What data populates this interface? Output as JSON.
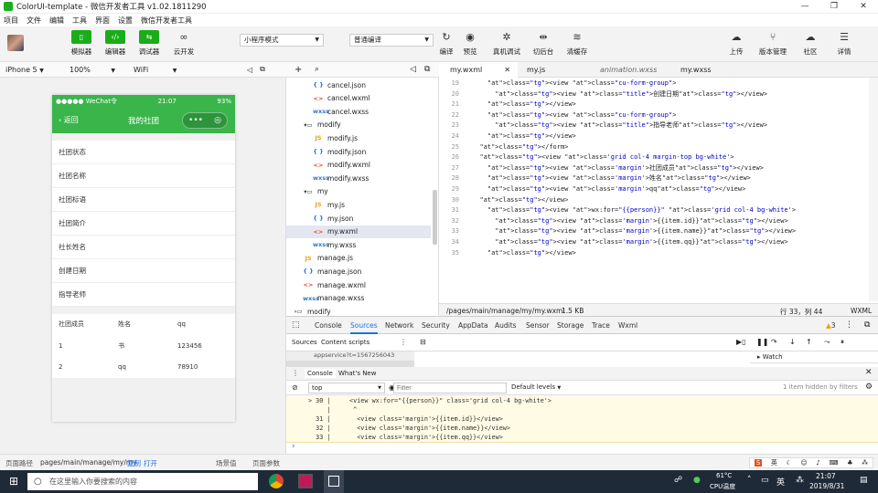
{
  "window": {
    "title": "ColorUI-template - 微信开发者工具 v1.02.1811290",
    "minimize": "—",
    "maximize": "❐",
    "close": "✕"
  },
  "menu": [
    "项目",
    "文件",
    "编辑",
    "工具",
    "界面",
    "设置",
    "微信开发者工具"
  ],
  "toolbar": {
    "simulator": "模拟器",
    "editor": "编辑器",
    "debugger": "调试器",
    "cloud": "云开发",
    "mode": "小程序模式",
    "compile_mode": "普通编译",
    "compile": "编译",
    "preview": "预览",
    "real_debug": "真机调试",
    "switch_bg": "切后台",
    "clear_cache": "清缓存",
    "upload": "上传",
    "version": "版本管理",
    "community": "社区",
    "details": "详情"
  },
  "device": {
    "model": "iPhone 5",
    "zoom": "100%",
    "network": "WiFi"
  },
  "phone": {
    "carrier": "●●●●● WeChat令",
    "time": "21:07",
    "battery": "93%",
    "back": "‹ 返回",
    "page_title": "我的社团",
    "form_labels": [
      "社团状态",
      "社团名称",
      "社团标语",
      "社团简介",
      "社长姓名",
      "创建日期",
      "指导老师"
    ],
    "grid_header": [
      "社团成员",
      "姓名",
      "qq"
    ],
    "grid_rows": [
      [
        "1",
        "书",
        "123456"
      ],
      [
        "2",
        "qq",
        "78910"
      ]
    ]
  },
  "filetree": [
    {
      "name": "cancel.json",
      "type": "json",
      "indent": 3
    },
    {
      "name": "cancel.wxml",
      "type": "wxml",
      "indent": 3
    },
    {
      "name": "cancel.wxss",
      "type": "wxss",
      "indent": 3
    },
    {
      "name": "modify",
      "type": "folder",
      "indent": 2
    },
    {
      "name": "modify.js",
      "type": "js",
      "indent": 3
    },
    {
      "name": "modify.json",
      "type": "json",
      "indent": 3
    },
    {
      "name": "modify.wxml",
      "type": "wxml",
      "indent": 3
    },
    {
      "name": "modify.wxss",
      "type": "wxss",
      "indent": 3
    },
    {
      "name": "my",
      "type": "folder",
      "indent": 2
    },
    {
      "name": "my.js",
      "type": "js",
      "indent": 3
    },
    {
      "name": "my.json",
      "type": "json",
      "indent": 3
    },
    {
      "name": "my.wxml",
      "type": "wxml",
      "indent": 3,
      "selected": true
    },
    {
      "name": "my.wxss",
      "type": "wxss",
      "indent": 3
    },
    {
      "name": "manage.js",
      "type": "js",
      "indent": 2
    },
    {
      "name": "manage.json",
      "type": "json",
      "indent": 2
    },
    {
      "name": "manage.wxml",
      "type": "wxml",
      "indent": 2
    },
    {
      "name": "manage.wxss",
      "type": "wxss",
      "indent": 2
    },
    {
      "name": "modify",
      "type": "folder-closed",
      "indent": 1
    }
  ],
  "icons": {
    "js": "JS",
    "json": "{ }",
    "wxml": "<>",
    "wxss": "wxss",
    "folder": "▾▭",
    "folder-closed": "›▭"
  },
  "tabs": [
    "my.wxml",
    "my.js",
    "animation.wxss",
    "my.wxss"
  ],
  "code": [
    {
      "n": "19",
      "t": "    <view class=\"cu-form-group\">"
    },
    {
      "n": "20",
      "t": "      <view class=\"title\">创建日期</view>"
    },
    {
      "n": "21",
      "t": "    </view>"
    },
    {
      "n": "22",
      "t": "    <view class=\"cu-form-group\">"
    },
    {
      "n": "23",
      "t": "      <view class=\"title\">指导老师</view>"
    },
    {
      "n": "24",
      "t": "    </view>"
    },
    {
      "n": "25",
      "t": "  </form>"
    },
    {
      "n": "26",
      "t": "  <view class='grid col-4 margin-top bg-white'>"
    },
    {
      "n": "27",
      "t": "    <view class='margin'>社团成员</view>"
    },
    {
      "n": "28",
      "t": "    <view class='margin'>姓名</view>"
    },
    {
      "n": "29",
      "t": "    <view class='margin'>qq</view>"
    },
    {
      "n": "30",
      "t": "  </view>"
    },
    {
      "n": "31",
      "t": "    <view wx:for=\"{{person}}\" class='grid col-4 bg-white'>"
    },
    {
      "n": "32",
      "t": "      <view class='margin'>{{item.id}}</view>"
    },
    {
      "n": "33",
      "t": "      <view class='margin'>{{item.name}}</view>"
    },
    {
      "n": "34",
      "t": "      <view class='margin'>{{item.qq}}</view>"
    },
    {
      "n": "35",
      "t": "    </view>"
    }
  ],
  "editor_status": {
    "path": "/pages/main/manage/my/my.wxml",
    "size": "1.5 KB",
    "cursor": "行 33，列 44",
    "lang": "WXML"
  },
  "devtools": {
    "tabs": [
      "Console",
      "Sources",
      "Network",
      "Security",
      "AppData",
      "Audits",
      "Sensor",
      "Storage",
      "Trace",
      "Wxml"
    ],
    "active": "Sources",
    "warnings": "3",
    "sources_tabs": [
      "Sources",
      "Content scripts"
    ],
    "source_file": "appservice?t=1567256043",
    "watch": "Watch",
    "console_tabs": [
      "Console",
      "What's New"
    ],
    "context": "top",
    "filter": "Filter",
    "levels": "Default levels",
    "hidden": "1 item hidden by filters",
    "console_lines": [
      "> 30 |     <view wx:for=\"{{person}}\" class='grid col-4 bg-white'>",
      "     |      ^",
      "  31 |       <view class='margin'>{{item.id}}</view>",
      "  32 |       <view class='margin'>{{item.name}}</view>",
      "  33 |       <view class='margin'>{{item.qq}}</view>"
    ],
    "prompt": "›"
  },
  "pathbar": {
    "label": "页面路径",
    "path": "pages/main/manage/my/my",
    "copy": "复制",
    "open": "打开",
    "scene": "场景值",
    "params": "页面参数"
  },
  "taskbar": {
    "search": "在这里输入你要搜索的内容",
    "temp": "61°C",
    "cpu": "CPU温度",
    "ime": "英",
    "time": "21:07",
    "date": "2019/8/31"
  }
}
